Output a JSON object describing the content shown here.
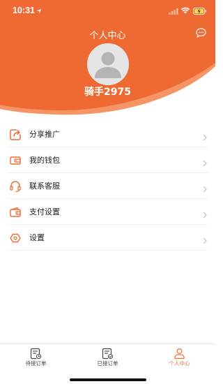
{
  "status_bar": {
    "time": "10:31"
  },
  "header": {
    "title": "个人中心",
    "username": "骑手2975",
    "colors": {
      "primary": "#EE6A32",
      "light": "#F59466"
    }
  },
  "menu": {
    "items": [
      {
        "label": "分享推广",
        "icon": "share-icon"
      },
      {
        "label": "我的钱包",
        "icon": "wallet-icon"
      },
      {
        "label": "联系客服",
        "icon": "headset-icon"
      },
      {
        "label": "支付设置",
        "icon": "payment-wallet-icon"
      },
      {
        "label": "设置",
        "icon": "settings-hexagon-icon"
      }
    ]
  },
  "tabbar": {
    "tabs": [
      {
        "label": "待接订单",
        "icon": "order-pending-icon",
        "active": false
      },
      {
        "label": "已接订单",
        "icon": "order-accepted-icon",
        "active": false
      },
      {
        "label": "个人中心",
        "icon": "profile-icon",
        "active": true
      }
    ],
    "active_color": "#F0733A"
  }
}
